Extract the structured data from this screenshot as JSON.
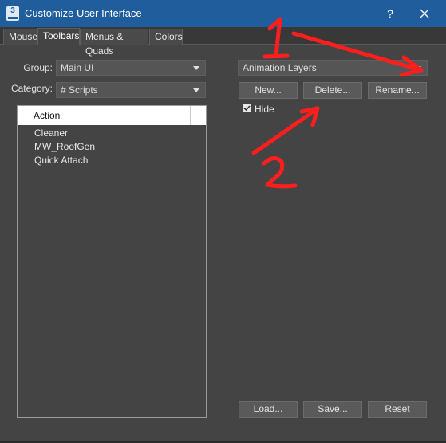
{
  "window": {
    "title": "Customize User Interface",
    "help_glyph": "?",
    "app_icon_text": "3"
  },
  "tabs": [
    {
      "label": "Mouse"
    },
    {
      "label": "Toolbars"
    },
    {
      "label": "Menus & Quads"
    },
    {
      "label": "Colors"
    }
  ],
  "active_tab": "Toolbars",
  "left": {
    "group_label": "Group:",
    "group_value": "Main UI",
    "category_label": "Category:",
    "category_value": "# Scripts",
    "list_header": "Action",
    "items": [
      "Cleaner",
      "MW_RoofGen",
      "Quick Attach"
    ]
  },
  "right": {
    "toolbar_value": "Animation Layers",
    "new_label": "New...",
    "delete_label": "Delete...",
    "rename_label": "Rename...",
    "hide_label": "Hide",
    "hide_checked": true
  },
  "footer": {
    "load_label": "Load...",
    "save_label": "Save...",
    "reset_label": "Reset"
  },
  "annotations": {
    "color": "#ff1e1e",
    "mark_1": "1",
    "mark_2": "2"
  },
  "colors": {
    "titlebar": "#1f5d9c",
    "panel": "#444444",
    "control": "#555555",
    "button": "#5a5a5a"
  }
}
